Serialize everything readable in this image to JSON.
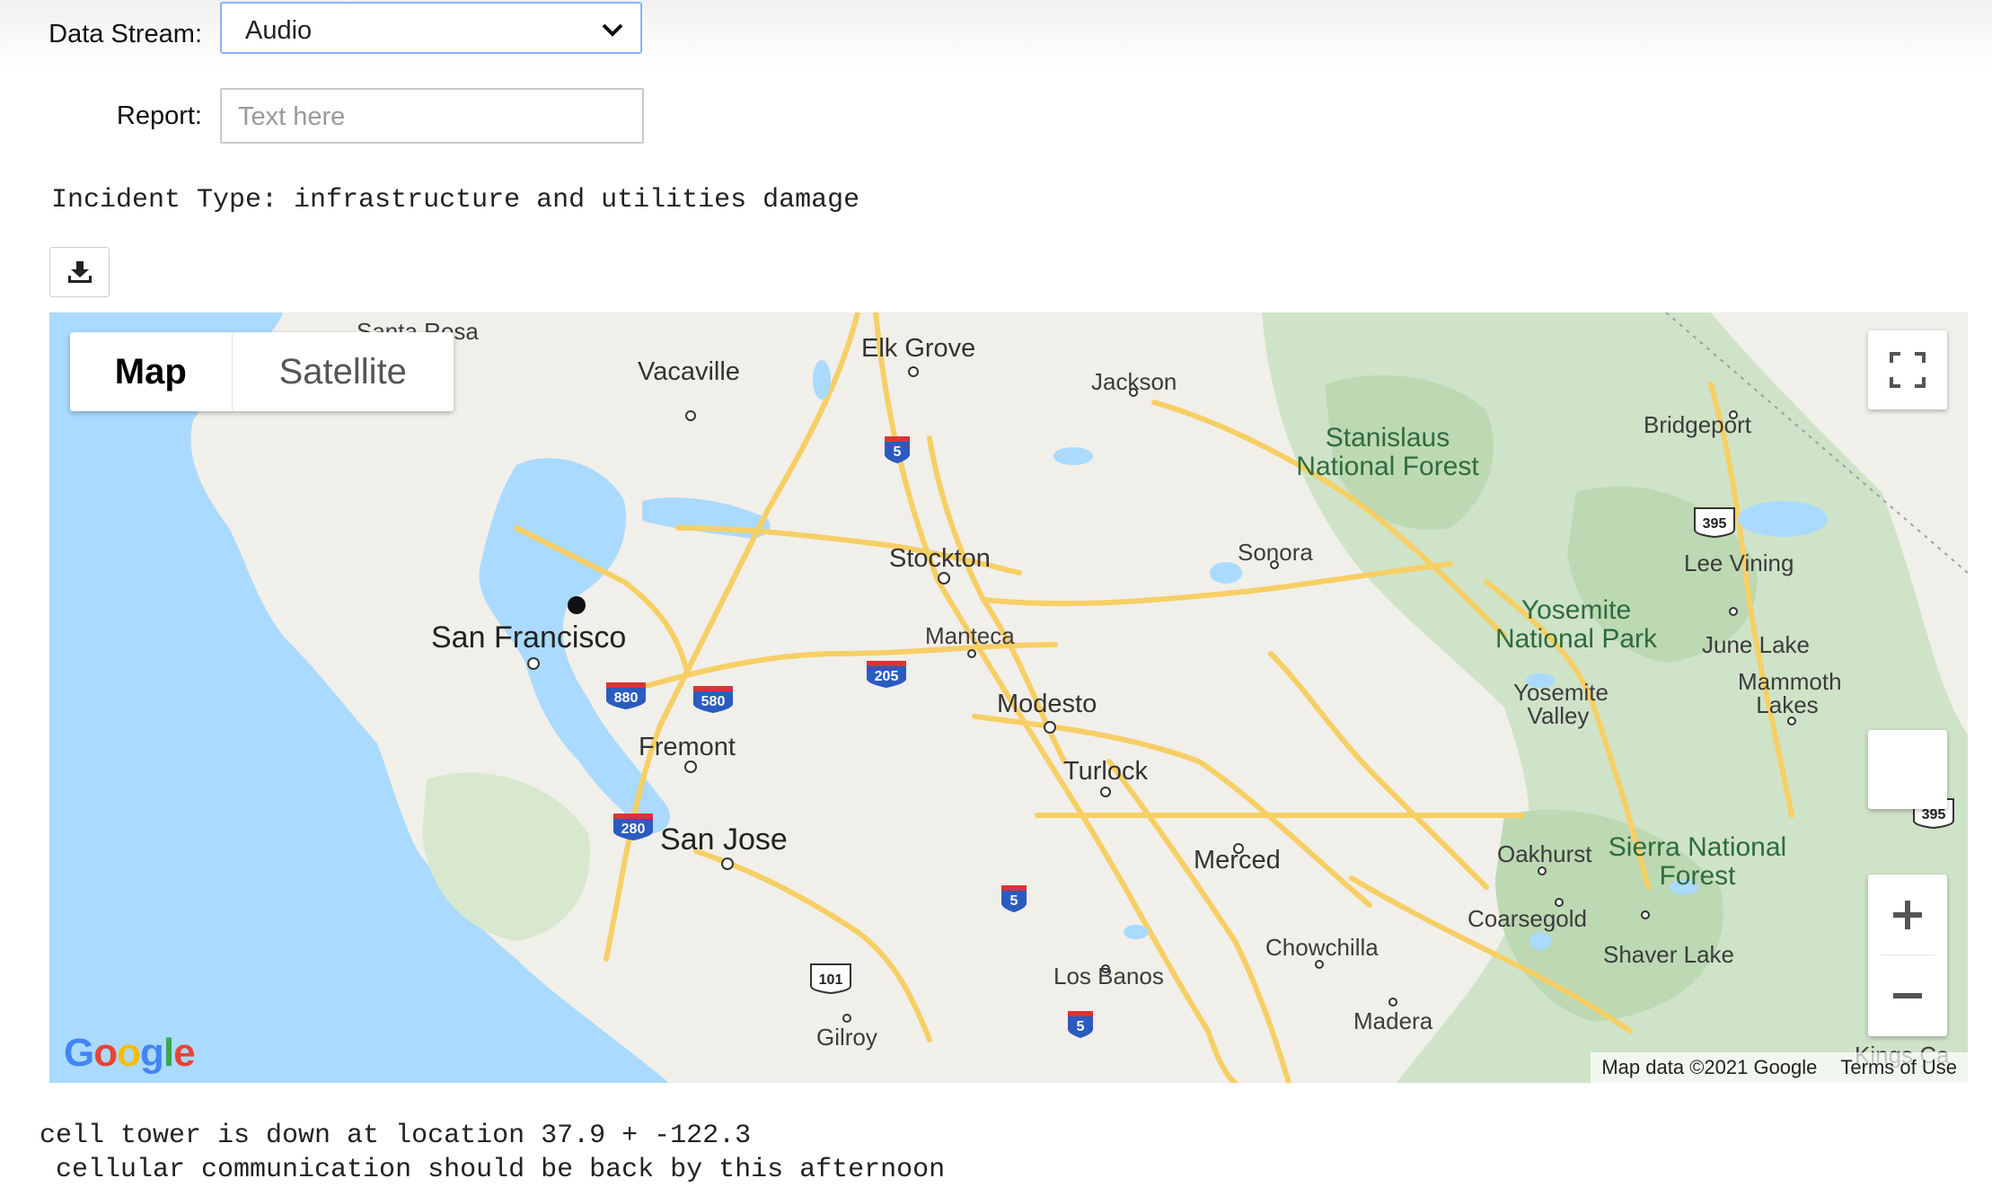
{
  "form": {
    "data_stream_label": "Data Stream:",
    "data_stream_value": "Audio",
    "report_label": "Report:",
    "report_placeholder": "Text here"
  },
  "incident_type_line": "Incident Type: infrastructure and utilities damage",
  "download_icon": "download-icon",
  "map": {
    "type_controls": {
      "map": "Map",
      "satellite": "Satellite"
    },
    "attribution": {
      "data": "Map data ©2021 Google",
      "terms": "Terms of Use"
    },
    "logo": "Google",
    "places": {
      "santa_rosa": "Santa Rosa",
      "vacaville": "Vacaville",
      "elk_grove": "Elk Grove",
      "jackson": "Jackson",
      "bridgeport": "Bridgeport",
      "stockton": "Stockton",
      "sonora": "Sonora",
      "lee_vining": "Lee Vining",
      "san_francisco": "San Francisco",
      "manteca": "Manteca",
      "june_lake": "June Lake",
      "modesto": "Modesto",
      "fremont": "Fremont",
      "turlock": "Turlock",
      "san_jose": "San Jose",
      "merced": "Merced",
      "oakhurst": "Oakhurst",
      "coarsegold": "Coarsegold",
      "chowchilla": "Chowchilla",
      "shaver_lake": "Shaver Lake",
      "los_banos": "Los Banos",
      "madera": "Madera",
      "gilroy": "Gilroy",
      "yosemite_valley": "Yosemite Valley",
      "mammoth_lakes": "Mammoth Lakes",
      "kings_ca": "Kings Ca"
    },
    "parks": {
      "stanislaus": "Stanislaus National Forest",
      "yosemite": "Yosemite National Park",
      "sierra": "Sierra National Forest"
    },
    "shields": [
      "5",
      "205",
      "880",
      "580",
      "280",
      "5",
      "101",
      "5",
      "395",
      "395"
    ]
  },
  "report_output": {
    "line1": "cell tower is down at location 37.9 + -122.3",
    "line2": " cellular communication should be back by this afternoon"
  }
}
